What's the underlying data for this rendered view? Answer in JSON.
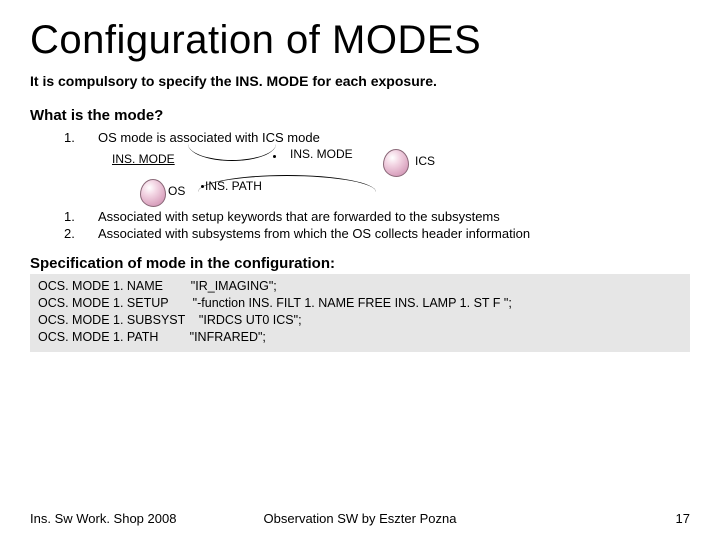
{
  "title": "Configuration of MODES",
  "intro": "It is compulsory to specify the INS. MODE for each exposure.",
  "heading_mode": "What is the mode?",
  "items": [
    {
      "num": "1.",
      "text": "OS mode is associated with ICS mode"
    },
    {
      "num": "1.",
      "text": "Associated with setup keywords that are forwarded to the subsystems"
    },
    {
      "num": "2.",
      "text": "Associated with subsystems from which the OS collects header information"
    }
  ],
  "diagram": {
    "insmode_left": "INS. MODE",
    "insmode_right": "INS. MODE",
    "inspath": "INS. PATH",
    "os": "OS",
    "ics": "ICS"
  },
  "spec_heading": "Specification of mode in the configuration:",
  "code": "OCS. MODE 1. NAME        \"IR_IMAGING\";\nOCS. MODE 1. SETUP       \"-function INS. FILT 1. NAME FREE INS. LAMP 1. ST F \";\nOCS. MODE 1. SUBSYST    \"IRDCS UT0 ICS\";\nOCS. MODE 1. PATH         \"INFRARED\";",
  "footer": {
    "left": "Ins. Sw Work. Shop 2008",
    "center": "Observation SW by Eszter Pozna",
    "right": "17"
  }
}
